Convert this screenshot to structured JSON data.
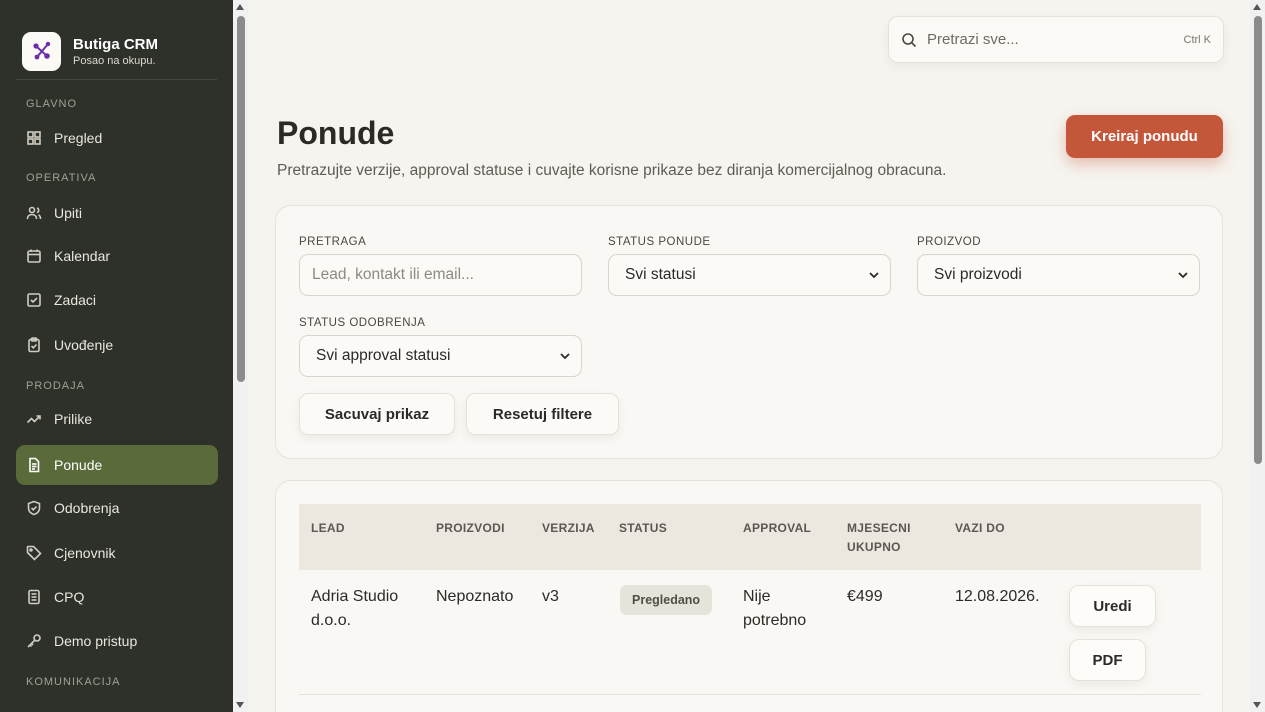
{
  "brand": {
    "name": "Butiga CRM",
    "tagline": "Posao na okupu."
  },
  "sidebar": {
    "sections": {
      "glavno": "GLAVNO",
      "operativa": "OPERATIVA",
      "prodaja": "PRODAJA",
      "komunikacija": "KOMUNIKACIJA"
    },
    "items": [
      {
        "label": "Pregled",
        "icon": "grid-icon"
      },
      {
        "label": "Upiti",
        "icon": "users-icon"
      },
      {
        "label": "Kalendar",
        "icon": "calendar-icon"
      },
      {
        "label": "Zadaci",
        "icon": "checkbox-icon"
      },
      {
        "label": "Uvođenje",
        "icon": "clipboard-icon"
      },
      {
        "label": "Prilike",
        "icon": "trend-icon"
      },
      {
        "label": "Ponude",
        "icon": "document-icon",
        "active": true
      },
      {
        "label": "Odobrenja",
        "icon": "shield-icon"
      },
      {
        "label": "Cjenovnik",
        "icon": "tag-icon"
      },
      {
        "label": "CPQ",
        "icon": "file-icon"
      },
      {
        "label": "Demo pristup",
        "icon": "key-icon"
      }
    ]
  },
  "search": {
    "placeholder": "Pretrazi sve...",
    "shortcut": "Ctrl K"
  },
  "page": {
    "title": "Ponude",
    "subtitle": "Pretrazujte verzije, approval statuse i cuvajte korisne prikaze bez diranja komercijalnog obracuna.",
    "create_label": "Kreiraj ponudu"
  },
  "filters": {
    "search_label": "PRETRAGA",
    "search_placeholder": "Lead, kontakt ili email...",
    "status_label": "STATUS PONUDE",
    "status_value": "Svi statusi",
    "product_label": "PROIZVOD",
    "product_value": "Svi proizvodi",
    "approval_label": "STATUS ODOBRENJA",
    "approval_value": "Svi approval statusi",
    "save_label": "Sacuvaj prikaz",
    "reset_label": "Resetuj filtere"
  },
  "table": {
    "headers": {
      "lead": "LEAD",
      "products": "PROIZVODI",
      "version": "VERZIJA",
      "status": "STATUS",
      "approval": "APPROVAL",
      "monthly_1": "MJESECNI",
      "monthly_2": "UKUPNO",
      "valid": "VAZI DO"
    },
    "rows": [
      {
        "lead_1": "Adria Studio",
        "lead_2": "d.o.o.",
        "products": "Nepoznato",
        "version": "v3",
        "status": "Pregledano",
        "approval_1": "Nije",
        "approval_2": "potrebno",
        "monthly": "€499",
        "valid": "12.08.2026.",
        "edit_label": "Uredi",
        "pdf_label": "PDF"
      }
    ]
  },
  "colors": {
    "accent": "#c4573a",
    "sidebar": "#2d3129",
    "active_nav": "#5a6a3a"
  }
}
